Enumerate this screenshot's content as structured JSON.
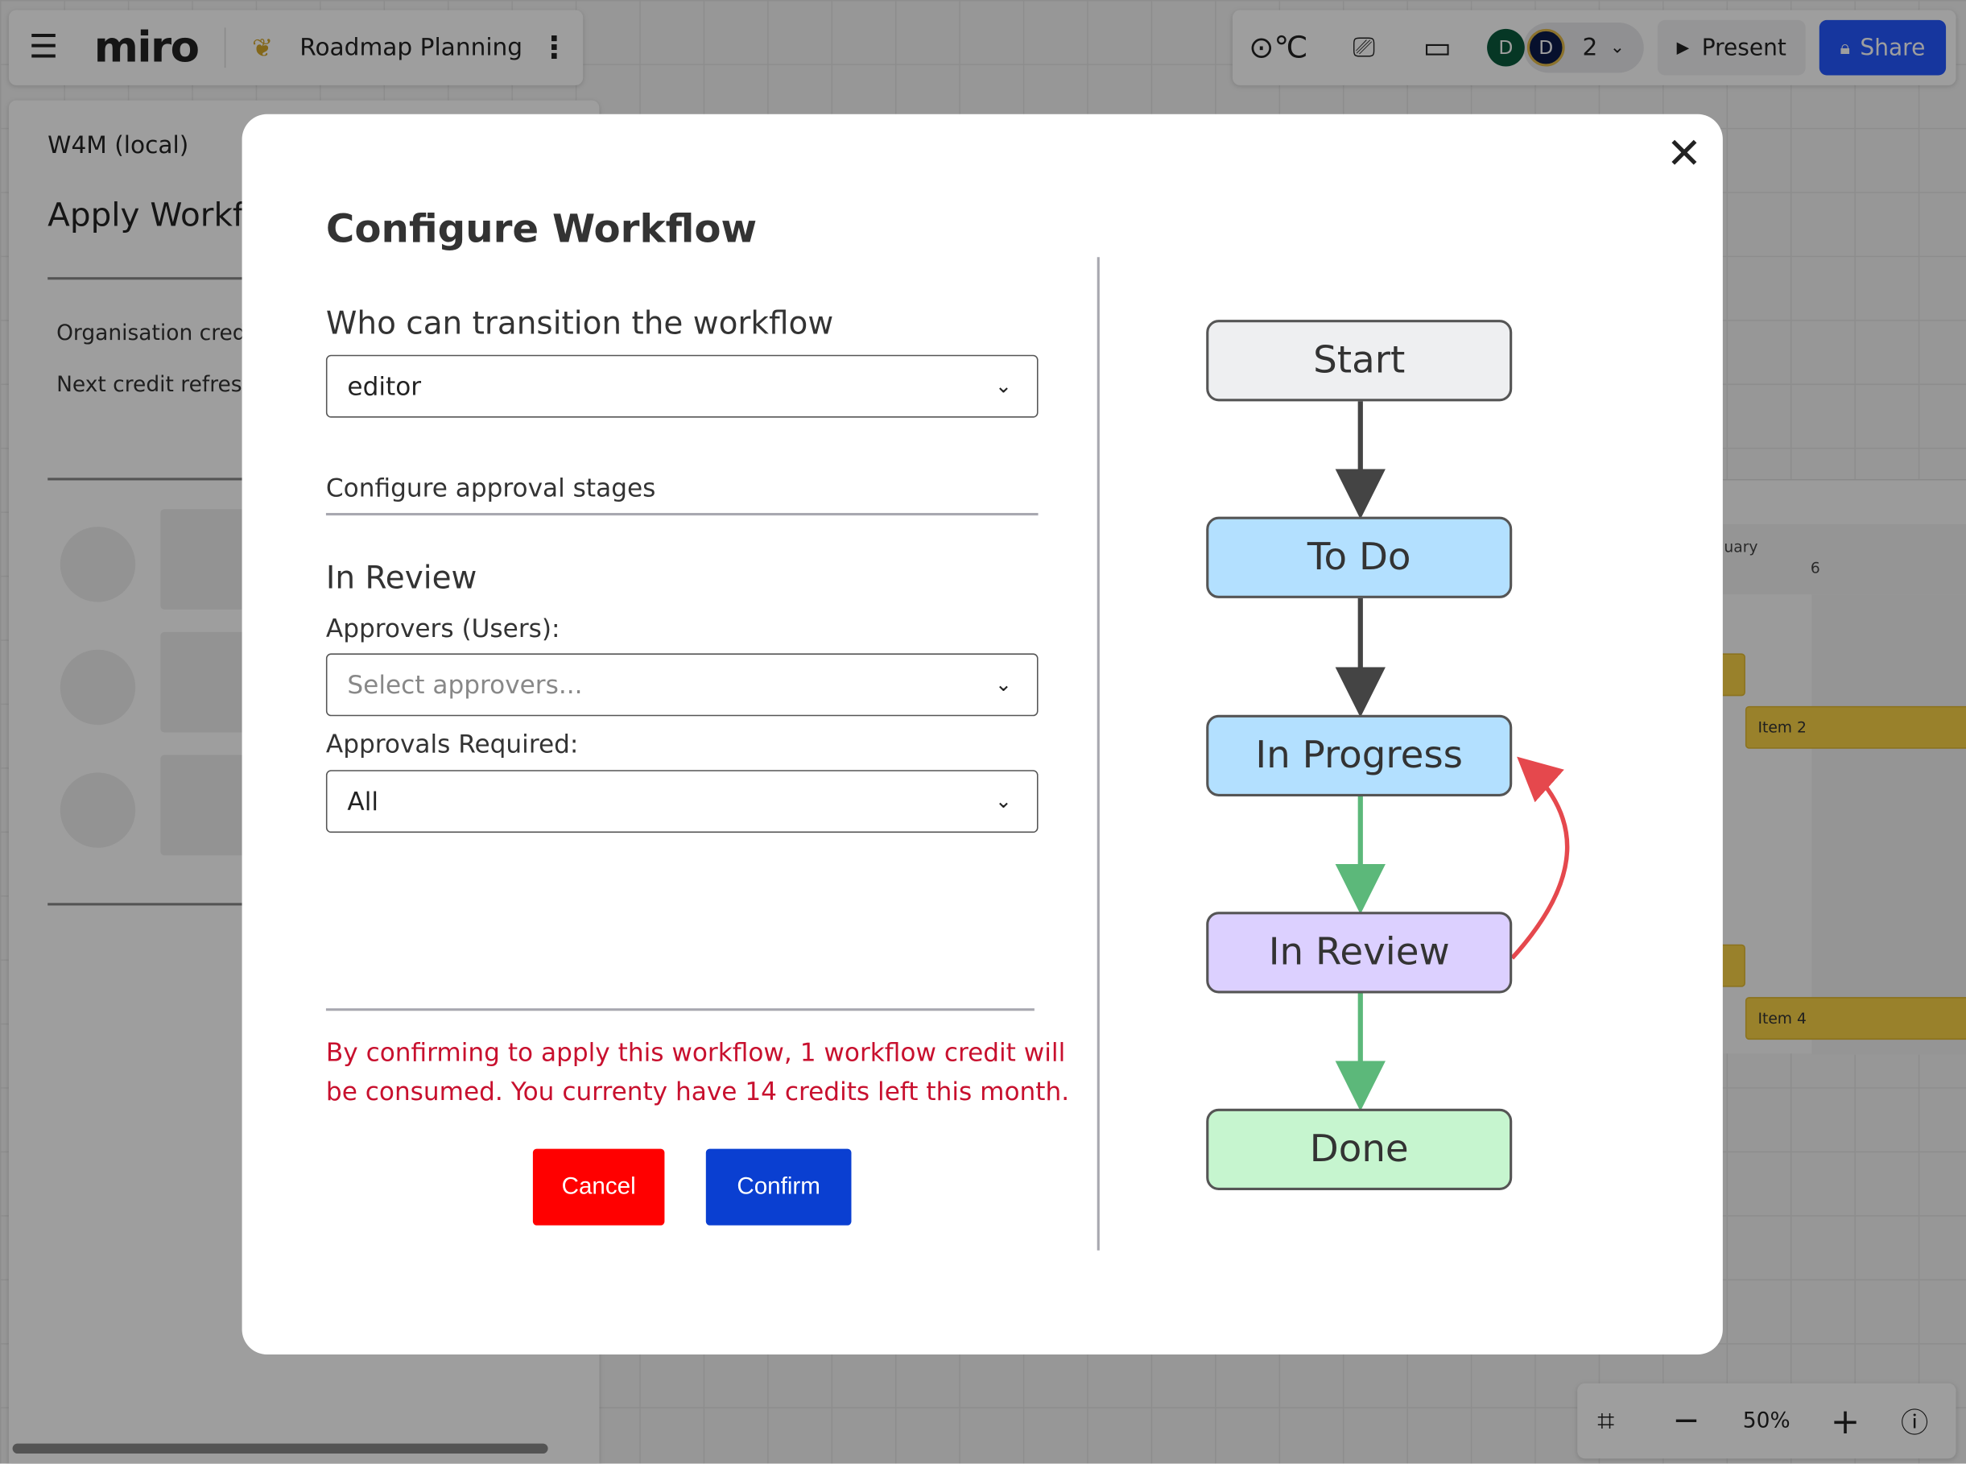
{
  "topbar": {
    "logo": "miro",
    "board_title": "Roadmap Planning",
    "present_label": "Present",
    "share_label": "Share",
    "avatars": [
      {
        "initial": "D",
        "color": "#0b5a3c"
      },
      {
        "initial": "D",
        "color": "#0c1a4a"
      }
    ],
    "collaborator_count": "2"
  },
  "sidebar": {
    "app_name": "W4M (local)",
    "heading": "Apply Workfl",
    "org_credits_label": "Organisation cred",
    "next_refresh_label": "Next credit refres"
  },
  "timeline": {
    "month": "uary",
    "day": "6",
    "items": [
      "Item 2",
      "Item 4"
    ]
  },
  "zoom": {
    "level": "50%"
  },
  "modal": {
    "title": "Configure Workflow",
    "who_label": "Who can transition the workflow",
    "who_value": "editor",
    "stages_tab": "Configure approval stages",
    "stage_name": "In Review",
    "approvers_label": "Approvers (Users):",
    "approvers_placeholder": "Select approvers...",
    "approvals_required_label": "Approvals Required:",
    "approvals_required_value": "All",
    "warning_line1": "By confirming to apply this workflow, 1 workflow credit will",
    "warning_line2": "be consumed. You currenty have 14 credits left this month.",
    "cancel_label": "Cancel",
    "confirm_label": "Confirm"
  },
  "diagram": {
    "nodes": [
      {
        "label": "Start",
        "color": "#eeeff1"
      },
      {
        "label": "To Do",
        "color": "#b3e0ff"
      },
      {
        "label": "In Progress",
        "color": "#b3e0ff"
      },
      {
        "label": "In Review",
        "color": "#dcd0ff"
      },
      {
        "label": "Done",
        "color": "#c6f5cf"
      }
    ],
    "edge_colors": {
      "default": "#444444",
      "approval": "#5cb87a",
      "reject": "#e5484d"
    }
  },
  "colors": {
    "share": "#2458ff",
    "cancel": "#ff0000",
    "confirm": "#0a3fd1",
    "warning": "#c8102e"
  }
}
